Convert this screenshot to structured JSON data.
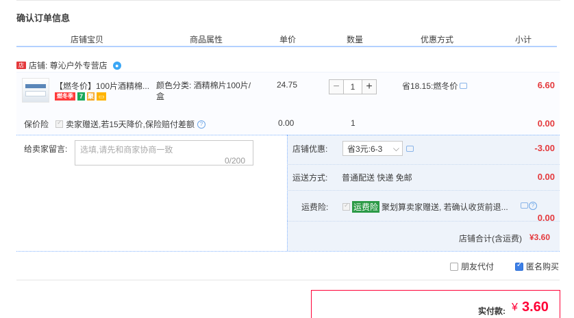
{
  "page": {
    "title": "确认订单信息"
  },
  "columns": [
    "店铺宝贝",
    "商品属性",
    "单价",
    "数量",
    "优惠方式",
    "小计"
  ],
  "shop": {
    "badge": "店",
    "label": "店铺: 尊沁户外专营店"
  },
  "item": {
    "title": "【燃冬价】100片酒精棉...",
    "tags": [
      "燃冬季",
      "7",
      "聚"
    ],
    "attr": "颜色分类: 酒精棉片100片/盒",
    "price": "24.75",
    "qty": "1",
    "promo": "省18.15:燃冬价",
    "subtotal": "6.60"
  },
  "insurance": {
    "label": "保价险",
    "text": "卖家赠送,若15天降价,保险赔付差额",
    "price": "0.00",
    "qty": "1",
    "subtotal": "0.00"
  },
  "message": {
    "label": "给卖家留言:",
    "placeholder": "选填,请先和商家协商一致",
    "count": "0/200"
  },
  "shop_discount": {
    "label": "店铺优惠:",
    "selected": "省3元:6-3",
    "amount": "-3.00"
  },
  "shipping": {
    "label": "运送方式:",
    "value": "普通配送 快递 免邮",
    "amount": "0.00"
  },
  "freight_ins": {
    "label": "运费险:",
    "tag": "运费险",
    "text": "聚划算卖家赠送, 若确认收货前退...",
    "amount": "0.00"
  },
  "shop_total": {
    "label": "店铺合计(含运费)",
    "value": "¥3.60"
  },
  "options": {
    "friend_pay": "朋友代付",
    "anonymous": "匿名购买"
  },
  "pay": {
    "label": "实付款:",
    "currency": "¥",
    "value": "3.60"
  },
  "colors": {
    "accent_red": "#ff0036",
    "price_red": "#e4393c",
    "link_blue": "#3d7fe6",
    "panel_bg": "#eef3fa"
  }
}
